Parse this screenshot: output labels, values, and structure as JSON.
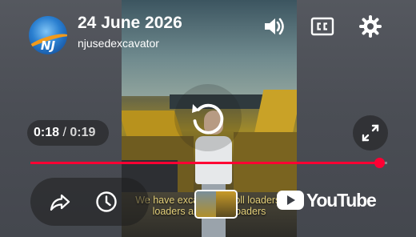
{
  "header": {
    "title": "24 June 2026",
    "channel": "njusedexcavator",
    "logo_text": "NJ"
  },
  "video": {
    "subtitle_line1": "We have excavators, roll loaders,",
    "subtitle_line2": "loaders and other loaders"
  },
  "controls": {
    "current_time": "0:18",
    "separator": "/",
    "duration": "0:19",
    "progress": 0.978,
    "youtube_label": "YouTube"
  },
  "icons": {
    "volume": "volume-icon",
    "captions": "closed-captions-icon",
    "settings": "gear-icon",
    "replay": "replay-icon",
    "fullscreen": "fullscreen-icon",
    "share": "share-icon",
    "watch_later": "clock-icon"
  },
  "colors": {
    "progress": "#ff0033",
    "text": "#ffffff",
    "overlay": "#4a4d54"
  }
}
